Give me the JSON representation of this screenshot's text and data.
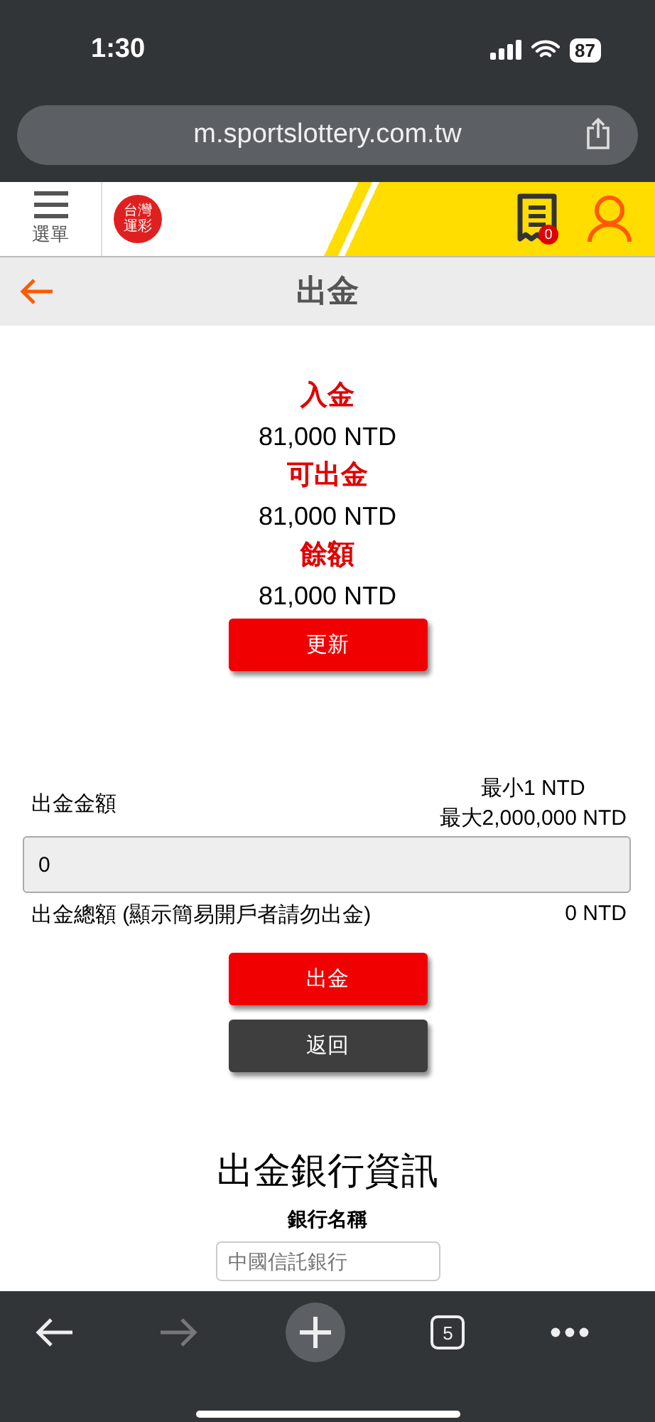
{
  "status_bar": {
    "time": "1:30",
    "battery": "87"
  },
  "browser": {
    "url": "m.sportslottery.com.tw",
    "tab_count": "5"
  },
  "header": {
    "menu_label": "選單",
    "logo_text": "台灣運彩",
    "ticket_count": "0"
  },
  "page": {
    "title": "出金"
  },
  "balances": [
    {
      "label": "入金",
      "value": "81,000 NTD"
    },
    {
      "label": "可出金",
      "value": "81,000 NTD"
    },
    {
      "label": "餘額",
      "value": "81,000 NTD"
    }
  ],
  "refresh_button": "更新",
  "withdraw": {
    "label": "出金金額",
    "min": "最小1 NTD",
    "max": "最大2,000,000 NTD",
    "value": "0",
    "total_label": "出金總額 (顯示簡易開戶者請勿出金)",
    "total_value": "0 NTD"
  },
  "buttons": [
    {
      "label": "出金",
      "kind": "primary"
    },
    {
      "label": "返回",
      "kind": "secondary"
    }
  ],
  "bank": {
    "heading": "出金銀行資訊",
    "name_label": "銀行名稱",
    "name_placeholder": "中國信託銀行"
  }
}
